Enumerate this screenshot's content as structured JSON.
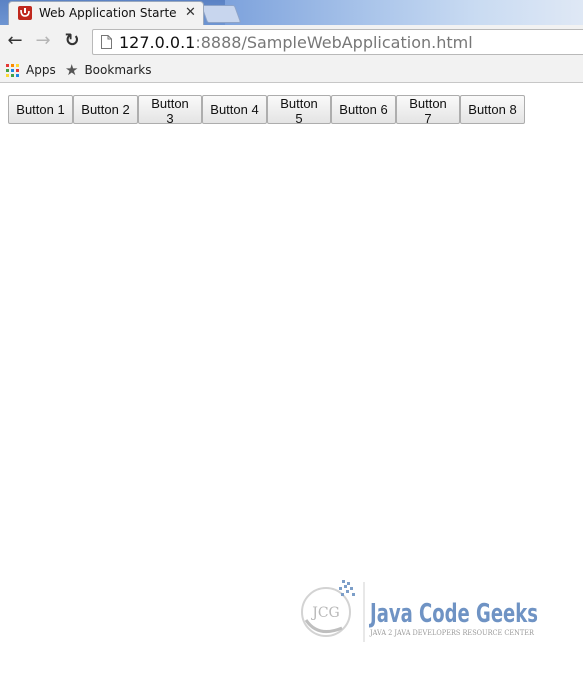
{
  "browser": {
    "tab": {
      "title": "Web Application Starter P",
      "close_glyph": "✕",
      "favicon": "gwt-logo-icon"
    },
    "nav": {
      "back_glyph": "←",
      "forward_glyph": "→",
      "reload_glyph": "↻"
    },
    "address": {
      "host": "127.0.0.1",
      "rest": ":8888/SampleWebApplication.html"
    },
    "bookmarks": {
      "apps_label": "Apps",
      "bookmarks_label": "Bookmarks"
    }
  },
  "page": {
    "buttons": [
      {
        "label": "Button 1"
      },
      {
        "label": "Button 2"
      },
      {
        "label": "Button 3"
      },
      {
        "label": "Button 4"
      },
      {
        "label": "Button 5"
      },
      {
        "label": "Button 6"
      },
      {
        "label": "Button 7"
      },
      {
        "label": "Button 8"
      }
    ]
  },
  "watermark": {
    "logo_text": "JCG",
    "brand": "Java Code Geeks",
    "tagline": "JAVA 2 JAVA DEVELOPERS RESOURCE CENTER"
  },
  "colors": {
    "tab_bar": "#5b82c4",
    "toolbar": "#f2f2f2",
    "brand_blue": "#4f7db8",
    "brand_green": "#8db84a"
  }
}
